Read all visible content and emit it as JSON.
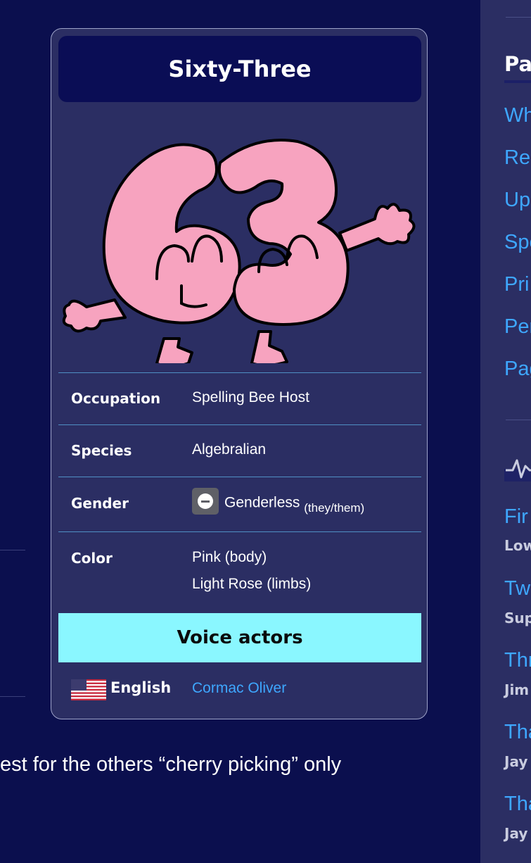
{
  "infobox": {
    "title": "Sixty-Three",
    "image_alt": "Sixty-Three character art",
    "rows": [
      {
        "label": "Occupation",
        "value": "Spelling Bee Host"
      },
      {
        "label": "Species",
        "value": "Algebralian"
      },
      {
        "label": "Gender",
        "value": "Genderless",
        "pronouns": "(they/them)",
        "icon": "genderless-icon"
      },
      {
        "label": "Color",
        "value_lines": [
          "Pink (body)",
          "Light Rose (limbs)"
        ]
      }
    ],
    "voice_actors_header": "Voice actors",
    "voice_actors": [
      {
        "language": "English",
        "flag": "us-flag-icon",
        "actor": "Cormac Oliver"
      }
    ]
  },
  "body": {
    "text_fragment": "est for the others “cherry picking” only"
  },
  "sidebar": {
    "heading": "Pa",
    "links": [
      "Wh",
      "Rel",
      "Up",
      "Spe",
      "Pri",
      "Per",
      "Pag"
    ],
    "activity_icon": "activity-pulse-icon",
    "activity": [
      {
        "title": "Fir",
        "subtitle": "Low"
      },
      {
        "title": "Tw",
        "subtitle": "Sup"
      },
      {
        "title": "Thr",
        "subtitle": "Jim"
      },
      {
        "title": "Tha",
        "subtitle": "Jay"
      },
      {
        "title": "Tha",
        "subtitle": "Jay"
      }
    ]
  },
  "colors": {
    "page_bg": "#0b0f4e",
    "panel_bg": "#2b2e63",
    "title_bg": "#0a0d55",
    "accent_cyan": "#8af7ff",
    "link_blue": "#3ea7ff"
  }
}
